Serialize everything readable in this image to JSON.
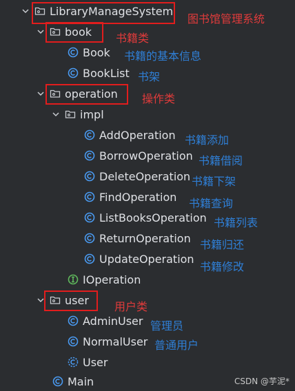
{
  "tree": {
    "root": {
      "label": "LibraryManageSystem",
      "annotation": "图书馆管理系统"
    },
    "book": {
      "label": "book",
      "annotation": "书籍类"
    },
    "book_class": {
      "label": "Book",
      "annotation": "书籍的基本信息"
    },
    "booklist_class": {
      "label": "BookList",
      "annotation": "书架"
    },
    "operation": {
      "label": "operation",
      "annotation": "操作类"
    },
    "impl": {
      "label": "impl"
    },
    "add": {
      "label": "AddOperation",
      "annotation": "书籍添加"
    },
    "borrow": {
      "label": "BorrowOperation",
      "annotation": "书籍借阅"
    },
    "delete": {
      "label": "DeleteOperation",
      "annotation": "书籍下架"
    },
    "find": {
      "label": "FindOperation",
      "annotation": "书籍查询"
    },
    "list": {
      "label": "ListBooksOperation",
      "annotation": "书籍列表"
    },
    "return": {
      "label": "ReturnOperation",
      "annotation": "书籍归还"
    },
    "update": {
      "label": "UpdateOperation",
      "annotation": "书籍修改"
    },
    "ioperation": {
      "label": "IOperation"
    },
    "user": {
      "label": "user",
      "annotation": "用户类"
    },
    "adminuser": {
      "label": "AdminUser",
      "annotation": "管理员"
    },
    "normaluser": {
      "label": "NormalUser",
      "annotation": "普通用户"
    },
    "user_class": {
      "label": "User"
    },
    "main": {
      "label": "Main"
    }
  },
  "watermark": "CSDN @芋泥*",
  "colors": {
    "background": "#2b2d30",
    "annotation_blue": "#2f7fd6",
    "annotation_red": "#e03b3b",
    "highlight_box": "#e21d1d",
    "class_icon": "#4a9bf2",
    "interface_icon": "#5fb85c"
  }
}
